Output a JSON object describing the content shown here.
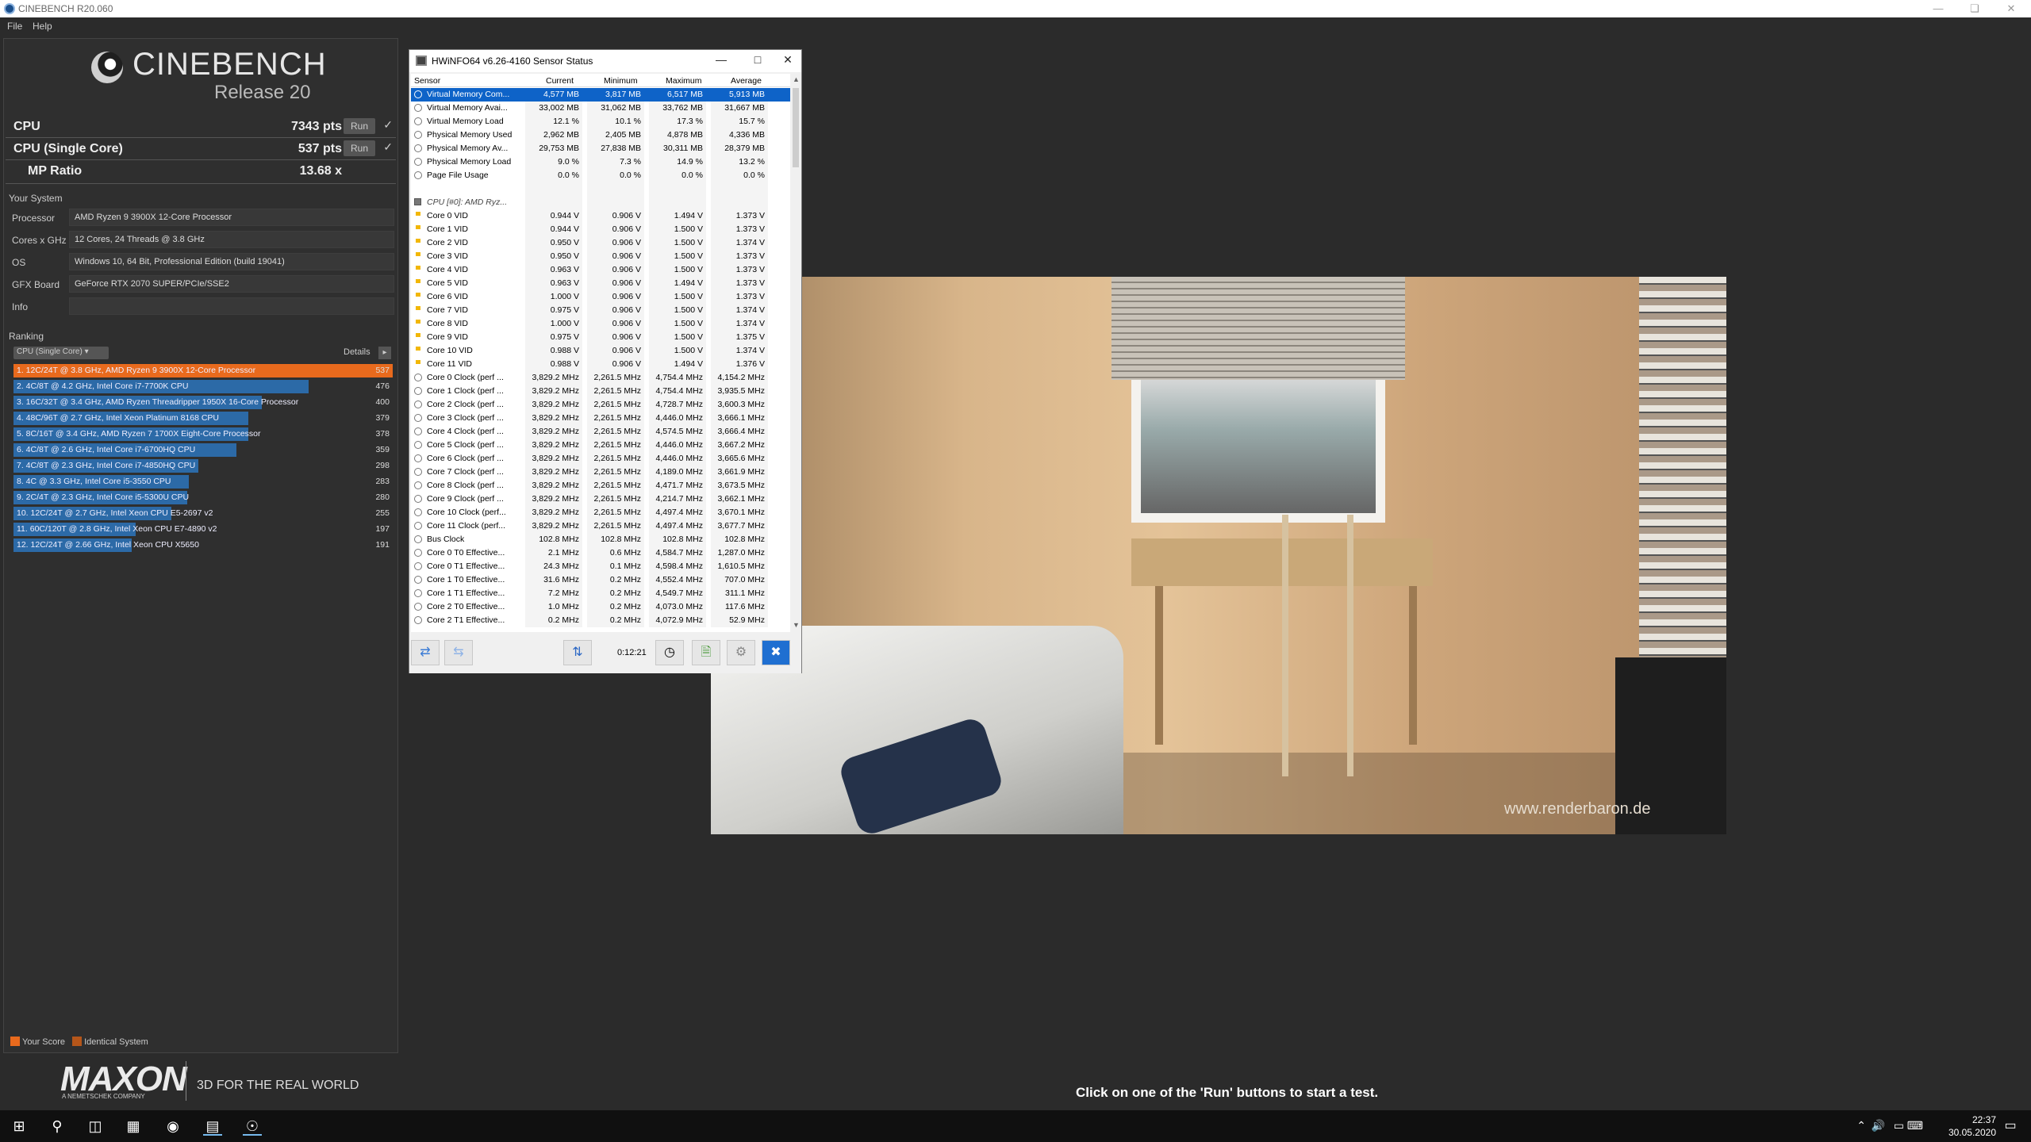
{
  "window": {
    "title": "CINEBENCH R20.060",
    "menu": [
      "File",
      "Help"
    ]
  },
  "logo": {
    "name": "CINEBENCH",
    "release": "Release 20"
  },
  "scores": [
    {
      "label": "CPU",
      "value": "7343 pts",
      "run": "Run",
      "check": "✓"
    },
    {
      "label": "CPU (Single Core)",
      "value": "537 pts",
      "run": "Run",
      "check": "✓"
    },
    {
      "label": "MP Ratio",
      "value": "13.68 x"
    }
  ],
  "system": {
    "heading": "Your System",
    "rows": [
      {
        "k": "Processor",
        "v": "AMD Ryzen 9 3900X 12-Core Processor"
      },
      {
        "k": "Cores x GHz",
        "v": "12 Cores, 24 Threads @ 3.8 GHz"
      },
      {
        "k": "OS",
        "v": "Windows 10, 64 Bit, Professional Edition (build 19041)"
      },
      {
        "k": "GFX Board",
        "v": "GeForce RTX 2070 SUPER/PCIe/SSE2"
      },
      {
        "k": "Info",
        "v": ""
      }
    ]
  },
  "ranking": {
    "heading": "Ranking",
    "select": "CPU (Single Core)",
    "details": "Details",
    "max": 537,
    "rows": [
      {
        "label": "1. 12C/24T @ 3.8 GHz, AMD Ryzen 9 3900X 12-Core Processor",
        "score": 537,
        "mine": true
      },
      {
        "label": "2. 4C/8T @ 4.2 GHz, Intel Core i7-7700K CPU",
        "score": 476
      },
      {
        "label": "3. 16C/32T @ 3.4 GHz, AMD Ryzen Threadripper 1950X 16-Core Processor",
        "score": 400
      },
      {
        "label": "4. 48C/96T @ 2.7 GHz, Intel Xeon Platinum 8168 CPU",
        "score": 379
      },
      {
        "label": "5. 8C/16T @ 3.4 GHz, AMD Ryzen 7 1700X Eight-Core Processor",
        "score": 378
      },
      {
        "label": "6. 4C/8T @ 2.6 GHz, Intel Core i7-6700HQ CPU",
        "score": 359
      },
      {
        "label": "7. 4C/8T @ 2.3 GHz, Intel Core i7-4850HQ CPU",
        "score": 298
      },
      {
        "label": "8. 4C @ 3.3 GHz, Intel Core i5-3550 CPU",
        "score": 283
      },
      {
        "label": "9. 2C/4T @ 2.3 GHz, Intel Core i5-5300U CPU",
        "score": 280
      },
      {
        "label": "10. 12C/24T @ 2.7 GHz, Intel Xeon CPU E5-2697 v2",
        "score": 255
      },
      {
        "label": "11. 60C/120T @ 2.8 GHz, Intel Xeon CPU E7-4890 v2",
        "score": 197
      },
      {
        "label": "12. 12C/24T @ 2.66 GHz, Intel Xeon CPU X5650",
        "score": 191
      }
    ],
    "legend": {
      "mine": "Your Score",
      "identical": "Identical System"
    }
  },
  "footer": {
    "brand": "MAXON",
    "sub": "A NEMETSCHEK COMPANY",
    "tagline": "3D FOR THE REAL WORLD",
    "hint": "Click on one of the 'Run' buttons to start a test."
  },
  "render": {
    "watermark": "www.renderbaron.de"
  },
  "hwinfo": {
    "title": "HWiNFO64 v6.26-4160 Sensor Status",
    "columns": [
      "Sensor",
      "Current",
      "Minimum",
      "Maximum",
      "Average"
    ],
    "timer": "0:12:21",
    "rows": [
      {
        "n": "Virtual Memory Com...",
        "c": "4,577 MB",
        "mi": "3,817 MB",
        "ma": "6,517 MB",
        "av": "5,913 MB",
        "sel": true
      },
      {
        "n": "Virtual Memory Avai...",
        "c": "33,002 MB",
        "mi": "31,062 MB",
        "ma": "33,762 MB",
        "av": "31,667 MB"
      },
      {
        "n": "Virtual Memory Load",
        "c": "12.1 %",
        "mi": "10.1 %",
        "ma": "17.3 %",
        "av": "15.7 %"
      },
      {
        "n": "Physical Memory Used",
        "c": "2,962 MB",
        "mi": "2,405 MB",
        "ma": "4,878 MB",
        "av": "4,336 MB"
      },
      {
        "n": "Physical Memory Av...",
        "c": "29,753 MB",
        "mi": "27,838 MB",
        "ma": "30,311 MB",
        "av": "28,379 MB"
      },
      {
        "n": "Physical Memory Load",
        "c": "9.0 %",
        "mi": "7.3 %",
        "ma": "14.9 %",
        "av": "13.2 %"
      },
      {
        "n": "Page File Usage",
        "c": "0.0 %",
        "mi": "0.0 %",
        "ma": "0.0 %",
        "av": "0.0 %"
      },
      {
        "n": "",
        "c": "",
        "mi": "",
        "ma": "",
        "av": "",
        "blank": true
      },
      {
        "n": "CPU [#0]: AMD Ryz...",
        "c": "",
        "mi": "",
        "ma": "",
        "av": "",
        "grp": true
      },
      {
        "n": "Core 0 VID",
        "c": "0.944 V",
        "mi": "0.906 V",
        "ma": "1.494 V",
        "av": "1.373 V",
        "v": true
      },
      {
        "n": "Core 1 VID",
        "c": "0.944 V",
        "mi": "0.906 V",
        "ma": "1.500 V",
        "av": "1.373 V",
        "v": true
      },
      {
        "n": "Core 2 VID",
        "c": "0.950 V",
        "mi": "0.906 V",
        "ma": "1.500 V",
        "av": "1.374 V",
        "v": true
      },
      {
        "n": "Core 3 VID",
        "c": "0.950 V",
        "mi": "0.906 V",
        "ma": "1.500 V",
        "av": "1.373 V",
        "v": true
      },
      {
        "n": "Core 4 VID",
        "c": "0.963 V",
        "mi": "0.906 V",
        "ma": "1.500 V",
        "av": "1.373 V",
        "v": true
      },
      {
        "n": "Core 5 VID",
        "c": "0.963 V",
        "mi": "0.906 V",
        "ma": "1.494 V",
        "av": "1.373 V",
        "v": true
      },
      {
        "n": "Core 6 VID",
        "c": "1.000 V",
        "mi": "0.906 V",
        "ma": "1.500 V",
        "av": "1.373 V",
        "v": true
      },
      {
        "n": "Core 7 VID",
        "c": "0.975 V",
        "mi": "0.906 V",
        "ma": "1.500 V",
        "av": "1.374 V",
        "v": true
      },
      {
        "n": "Core 8 VID",
        "c": "1.000 V",
        "mi": "0.906 V",
        "ma": "1.500 V",
        "av": "1.374 V",
        "v": true
      },
      {
        "n": "Core 9 VID",
        "c": "0.975 V",
        "mi": "0.906 V",
        "ma": "1.500 V",
        "av": "1.375 V",
        "v": true
      },
      {
        "n": "Core 10 VID",
        "c": "0.988 V",
        "mi": "0.906 V",
        "ma": "1.500 V",
        "av": "1.374 V",
        "v": true
      },
      {
        "n": "Core 11 VID",
        "c": "0.988 V",
        "mi": "0.906 V",
        "ma": "1.494 V",
        "av": "1.376 V",
        "v": true
      },
      {
        "n": "Core 0 Clock (perf ...",
        "c": "3,829.2 MHz",
        "mi": "2,261.5 MHz",
        "ma": "4,754.4 MHz",
        "av": "4,154.2 MHz"
      },
      {
        "n": "Core 1 Clock (perf ...",
        "c": "3,829.2 MHz",
        "mi": "2,261.5 MHz",
        "ma": "4,754.4 MHz",
        "av": "3,935.5 MHz"
      },
      {
        "n": "Core 2 Clock (perf ...",
        "c": "3,829.2 MHz",
        "mi": "2,261.5 MHz",
        "ma": "4,728.7 MHz",
        "av": "3,600.3 MHz"
      },
      {
        "n": "Core 3 Clock (perf ...",
        "c": "3,829.2 MHz",
        "mi": "2,261.5 MHz",
        "ma": "4,446.0 MHz",
        "av": "3,666.1 MHz"
      },
      {
        "n": "Core 4 Clock (perf ...",
        "c": "3,829.2 MHz",
        "mi": "2,261.5 MHz",
        "ma": "4,574.5 MHz",
        "av": "3,666.4 MHz"
      },
      {
        "n": "Core 5 Clock (perf ...",
        "c": "3,829.2 MHz",
        "mi": "2,261.5 MHz",
        "ma": "4,446.0 MHz",
        "av": "3,667.2 MHz"
      },
      {
        "n": "Core 6 Clock (perf ...",
        "c": "3,829.2 MHz",
        "mi": "2,261.5 MHz",
        "ma": "4,446.0 MHz",
        "av": "3,665.6 MHz"
      },
      {
        "n": "Core 7 Clock (perf ...",
        "c": "3,829.2 MHz",
        "mi": "2,261.5 MHz",
        "ma": "4,189.0 MHz",
        "av": "3,661.9 MHz"
      },
      {
        "n": "Core 8 Clock (perf ...",
        "c": "3,829.2 MHz",
        "mi": "2,261.5 MHz",
        "ma": "4,471.7 MHz",
        "av": "3,673.5 MHz"
      },
      {
        "n": "Core 9 Clock (perf ...",
        "c": "3,829.2 MHz",
        "mi": "2,261.5 MHz",
        "ma": "4,214.7 MHz",
        "av": "3,662.1 MHz"
      },
      {
        "n": "Core 10 Clock (perf...",
        "c": "3,829.2 MHz",
        "mi": "2,261.5 MHz",
        "ma": "4,497.4 MHz",
        "av": "3,670.1 MHz"
      },
      {
        "n": "Core 11 Clock (perf...",
        "c": "3,829.2 MHz",
        "mi": "2,261.5 MHz",
        "ma": "4,497.4 MHz",
        "av": "3,677.7 MHz"
      },
      {
        "n": "Bus Clock",
        "c": "102.8 MHz",
        "mi": "102.8 MHz",
        "ma": "102.8 MHz",
        "av": "102.8 MHz"
      },
      {
        "n": "Core 0 T0 Effective...",
        "c": "2.1 MHz",
        "mi": "0.6 MHz",
        "ma": "4,584.7 MHz",
        "av": "1,287.0 MHz"
      },
      {
        "n": "Core 0 T1 Effective...",
        "c": "24.3 MHz",
        "mi": "0.1 MHz",
        "ma": "4,598.4 MHz",
        "av": "1,610.5 MHz"
      },
      {
        "n": "Core 1 T0 Effective...",
        "c": "31.6 MHz",
        "mi": "0.2 MHz",
        "ma": "4,552.4 MHz",
        "av": "707.0 MHz"
      },
      {
        "n": "Core 1 T1 Effective...",
        "c": "7.2 MHz",
        "mi": "0.2 MHz",
        "ma": "4,549.7 MHz",
        "av": "311.1 MHz"
      },
      {
        "n": "Core 2 T0 Effective...",
        "c": "1.0 MHz",
        "mi": "0.2 MHz",
        "ma": "4,073.0 MHz",
        "av": "117.6 MHz"
      },
      {
        "n": "Core 2 T1 Effective...",
        "c": "0.2 MHz",
        "mi": "0.2 MHz",
        "ma": "4,072.9 MHz",
        "av": "52.9 MHz"
      }
    ]
  },
  "taskbar": {
    "time": "22:37",
    "date": "30.05.2020"
  },
  "colors": {
    "your_score": "#e86a1d",
    "identical": "#b5561a",
    "rank_bar": "#2c6aa7",
    "selection": "#0e63c8"
  }
}
